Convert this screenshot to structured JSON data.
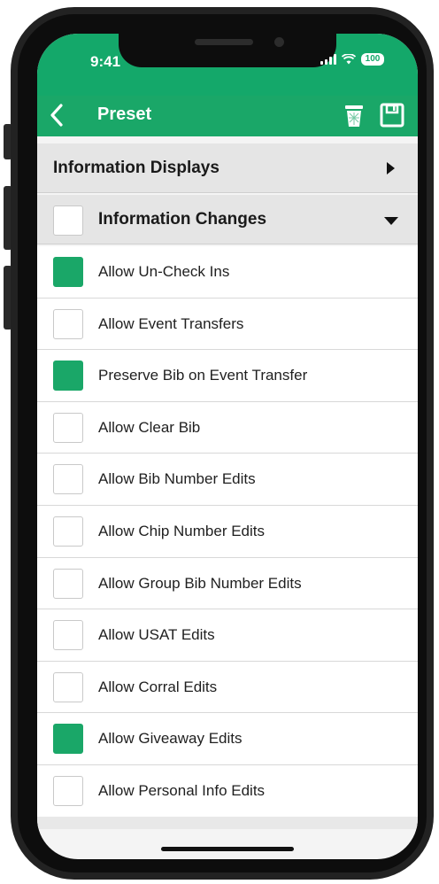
{
  "status": {
    "time": "9:41",
    "battery": "100"
  },
  "header": {
    "title": "Preset"
  },
  "sections": [
    {
      "label": "Information Displays",
      "state": "collapsed"
    },
    {
      "label": "Information Changes",
      "state": "expanded",
      "checked": false
    }
  ],
  "items": [
    {
      "label": "Allow Un-Check Ins",
      "checked": true
    },
    {
      "label": "Allow Event Transfers",
      "checked": false
    },
    {
      "label": "Preserve Bib on Event Transfer",
      "checked": true
    },
    {
      "label": "Allow Clear Bib",
      "checked": false
    },
    {
      "label": "Allow Bib Number Edits",
      "checked": false
    },
    {
      "label": "Allow Chip Number Edits",
      "checked": false
    },
    {
      "label": "Allow Group Bib Number Edits",
      "checked": false
    },
    {
      "label": "Allow USAT Edits",
      "checked": false
    },
    {
      "label": "Allow Corral Edits",
      "checked": false
    },
    {
      "label": "Allow Giveaway Edits",
      "checked": true
    },
    {
      "label": "Allow Personal Info Edits",
      "checked": false
    }
  ],
  "colors": {
    "accent": "#1aa768",
    "section_bg": "#e5e5e5"
  }
}
